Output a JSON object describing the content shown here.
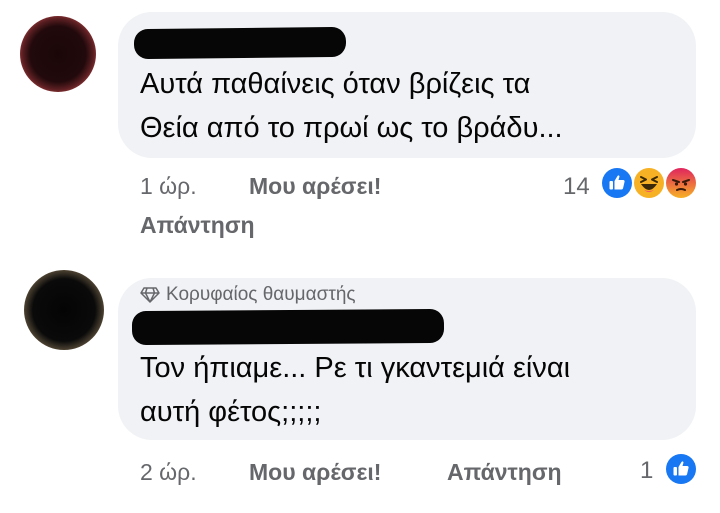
{
  "comments": [
    {
      "text_line1": "Αυτά παθαίνεις όταν βρίζεις τα",
      "text_line2": "Θεία από το πρωί ως το βράδυ...",
      "time": "1 ώρ.",
      "like_label": "Μου αρέσει!",
      "reply_label": "Απάντηση",
      "reaction_count": "14",
      "reactions": [
        "like-icon",
        "haha-icon",
        "angry-icon"
      ]
    },
    {
      "badge": "Κορυφαίος θαυμαστής",
      "badge_icon": "diamond-icon",
      "text_line1": "Τον ήπιαμε... Ρε τι γκαντεμιά είναι",
      "text_line2": "αυτή φέτος;;;;;",
      "time": "2 ώρ.",
      "like_label": "Μου αρέσει!",
      "reply_label": "Απάντηση",
      "reaction_count": "1",
      "reactions": [
        "like-icon"
      ]
    }
  ],
  "colors": {
    "bubble": "#f0f2f5",
    "meta_text": "#65676b",
    "like_blue": "#1877f2",
    "haha_yellow": "#f7b125",
    "angry_orange": "#e9710f"
  }
}
